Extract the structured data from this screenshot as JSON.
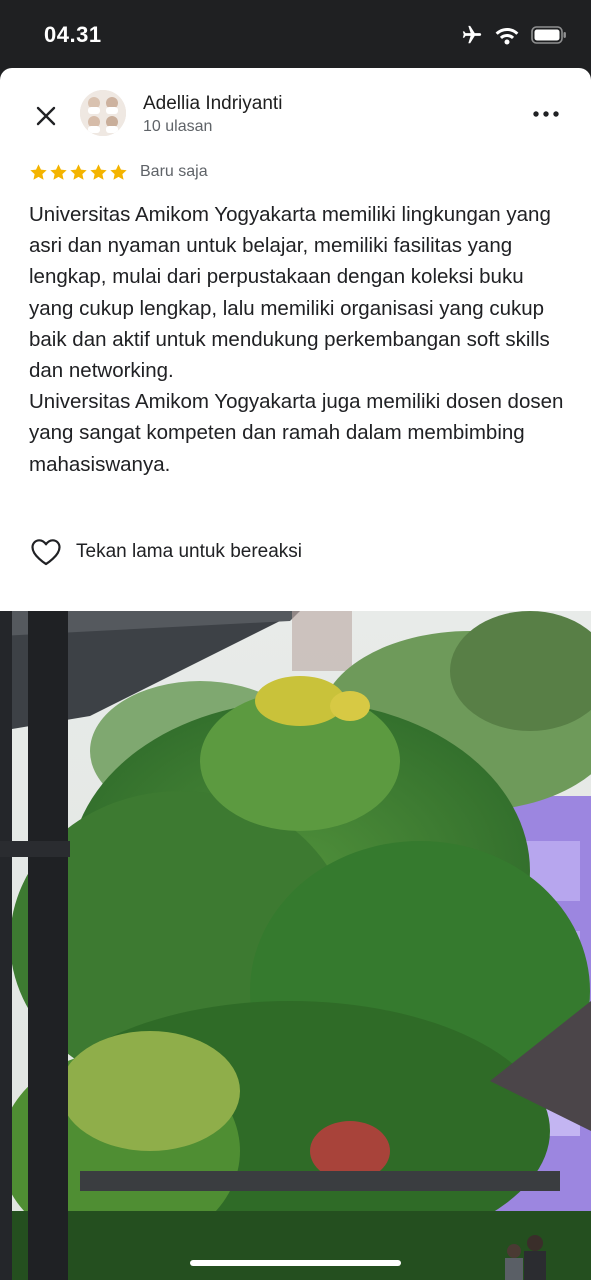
{
  "status_bar": {
    "time": "04.31",
    "icons": [
      "airplane-icon",
      "wifi-icon",
      "battery-icon"
    ]
  },
  "review": {
    "reviewer_name": "Adellia Indriyanti",
    "review_count": "10 ulasan",
    "rating": 5,
    "time_ago": "Baru saja",
    "paragraphs": [
      "Universitas Amikom Yogyakarta memiliki lingkungan yang asri dan nyaman untuk belajar, memiliki fasilitas yang lengkap, mulai dari perpustakaan dengan koleksi buku yang cukup lengkap, lalu memiliki organisasi yang cukup baik dan aktif untuk mendukung perkembangan soft skills dan networking.",
      "Universitas Amikom Yogyakarta juga memiliki dosen dosen yang sangat kompeten dan ramah dalam membimbing mahasiswanya."
    ],
    "react_label": "Tekan lama untuk bereaksi"
  },
  "colors": {
    "star": "#f4b400",
    "status_bar_bg": "#1f2022",
    "text": "#202124",
    "secondary_text": "#5f6368"
  }
}
